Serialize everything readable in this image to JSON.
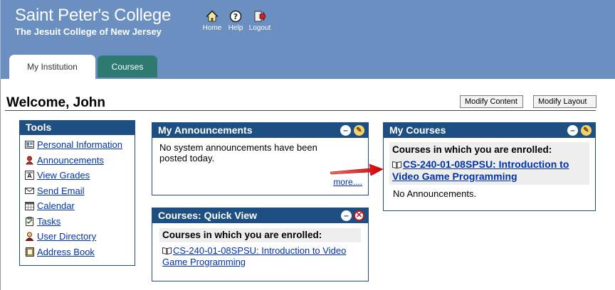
{
  "header": {
    "college_name": "Saint Peter's College",
    "college_sub": "The Jesuit College of New Jersey",
    "icons": [
      {
        "label": "Home",
        "icon": "home-icon"
      },
      {
        "label": "Help",
        "icon": "help-icon"
      },
      {
        "label": "Logout",
        "icon": "logout-icon"
      }
    ]
  },
  "tabs": [
    {
      "label": "My Institution",
      "active": true
    },
    {
      "label": "Courses",
      "active": false
    }
  ],
  "welcome": {
    "title": "Welcome, John",
    "modify_content": "Modify Content",
    "modify_layout": "Modify Layout"
  },
  "tools": {
    "title": "Tools",
    "items": [
      {
        "label": "Personal Information",
        "icon": "personal-info-icon"
      },
      {
        "label": "Announcements",
        "icon": "announcements-icon"
      },
      {
        "label": "View Grades",
        "icon": "grades-icon"
      },
      {
        "label": "Send Email",
        "icon": "email-icon"
      },
      {
        "label": "Calendar",
        "icon": "calendar-icon"
      },
      {
        "label": "Tasks",
        "icon": "tasks-icon"
      },
      {
        "label": "User Directory",
        "icon": "user-directory-icon"
      },
      {
        "label": "Address Book",
        "icon": "address-book-icon"
      }
    ]
  },
  "announcements": {
    "title": "My Announcements",
    "text": "No system announcements have been posted today.",
    "more": "more...."
  },
  "quick_view": {
    "title": "Courses: Quick View",
    "subheading": "Courses in which you are enrolled:",
    "course": "CS-240-01-08SPSU: Introduction to Video Game Programming"
  },
  "my_courses": {
    "title": "My Courses",
    "subheading": "Courses in which you are enrolled:",
    "course": "CS-240-01-08SPSU: Introduction to Video Game Programming",
    "no_announcements": "No Announcements."
  },
  "colors": {
    "header_bg": "#6a8fc0",
    "module_header": "#1e4f82",
    "tab_inactive": "#2e7a70",
    "link": "#0033aa",
    "arrow": "#e01010"
  }
}
